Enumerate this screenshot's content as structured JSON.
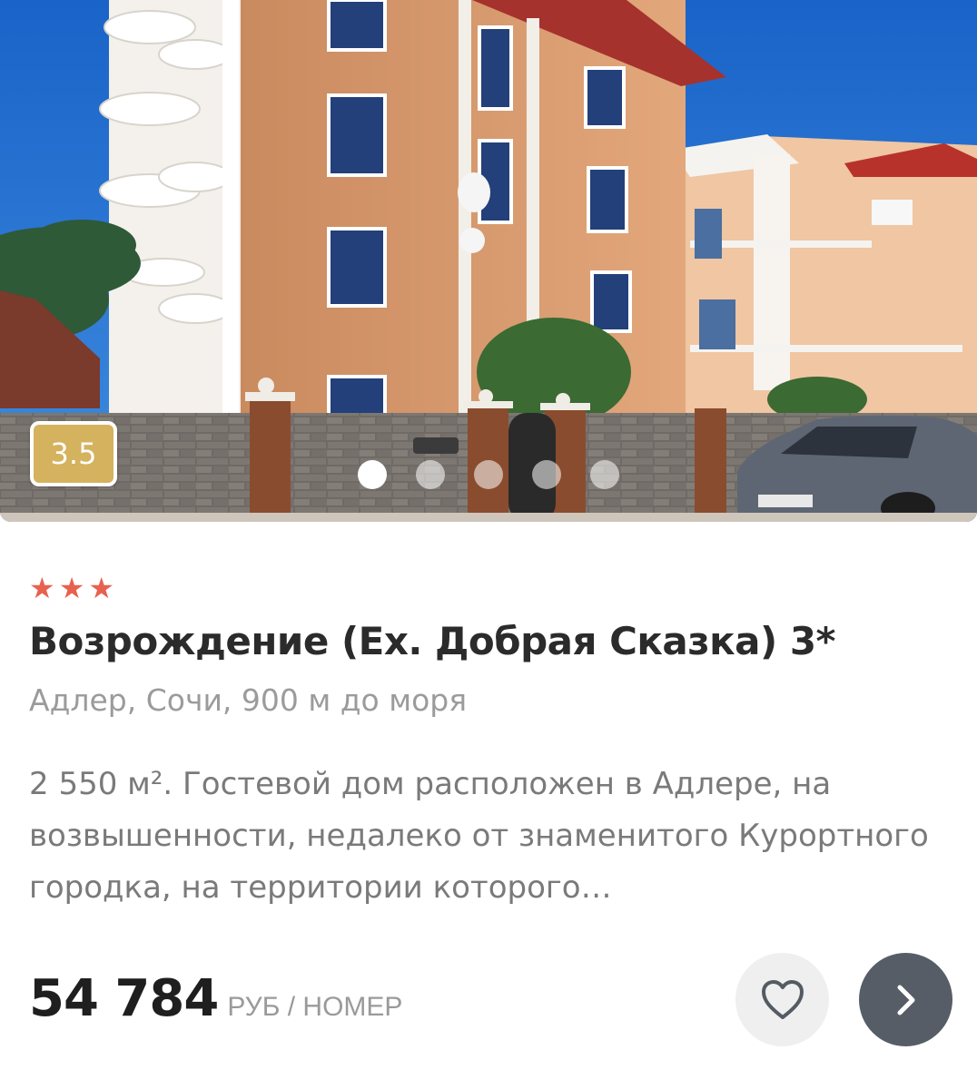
{
  "hotel": {
    "rating": "3.5",
    "stars_count": 3,
    "stars": [
      "★",
      "★",
      "★"
    ],
    "title": "Возрождение (Ex. Добрая Сказка) 3*",
    "location": "Адлер, Сочи, 900 м до моря",
    "description": "2 550 м². Гостевой дом расположен в Адлере, на возвышенности, недалеко от знаменитого Курортного городка, на территории которого…",
    "price": "54 784",
    "price_unit": "РУБ / НОМЕР"
  },
  "gallery": {
    "slides_total": 5,
    "active_slide": 1
  },
  "icons": {
    "favorite": "heart-icon",
    "open": "chevron-right-icon",
    "star": "star-icon"
  },
  "colors": {
    "rating_badge": "#d4b25e",
    "stars": "#e8614f",
    "go_button": "#565d66",
    "fav_button": "#efefef"
  }
}
